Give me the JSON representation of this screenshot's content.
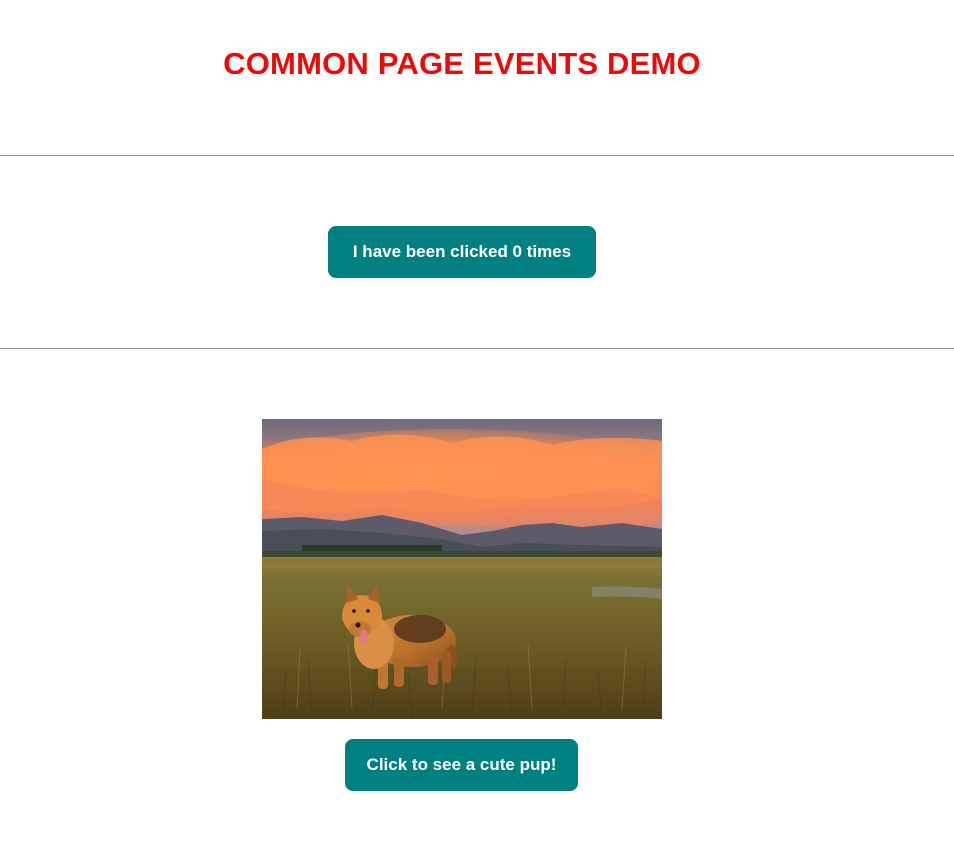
{
  "page": {
    "title": "COMMON PAGE EVENTS DEMO",
    "title_color": "#ea0a0a"
  },
  "counter_section": {
    "button_label": "I have been clicked 0 times",
    "click_count": 0,
    "button_color": "#008080"
  },
  "image_section": {
    "image_subject": "dog standing in a grassy meadow at sunset with mountains and orange clouds",
    "button_label": "Click to see a cute pup!",
    "button_color": "#008080"
  }
}
